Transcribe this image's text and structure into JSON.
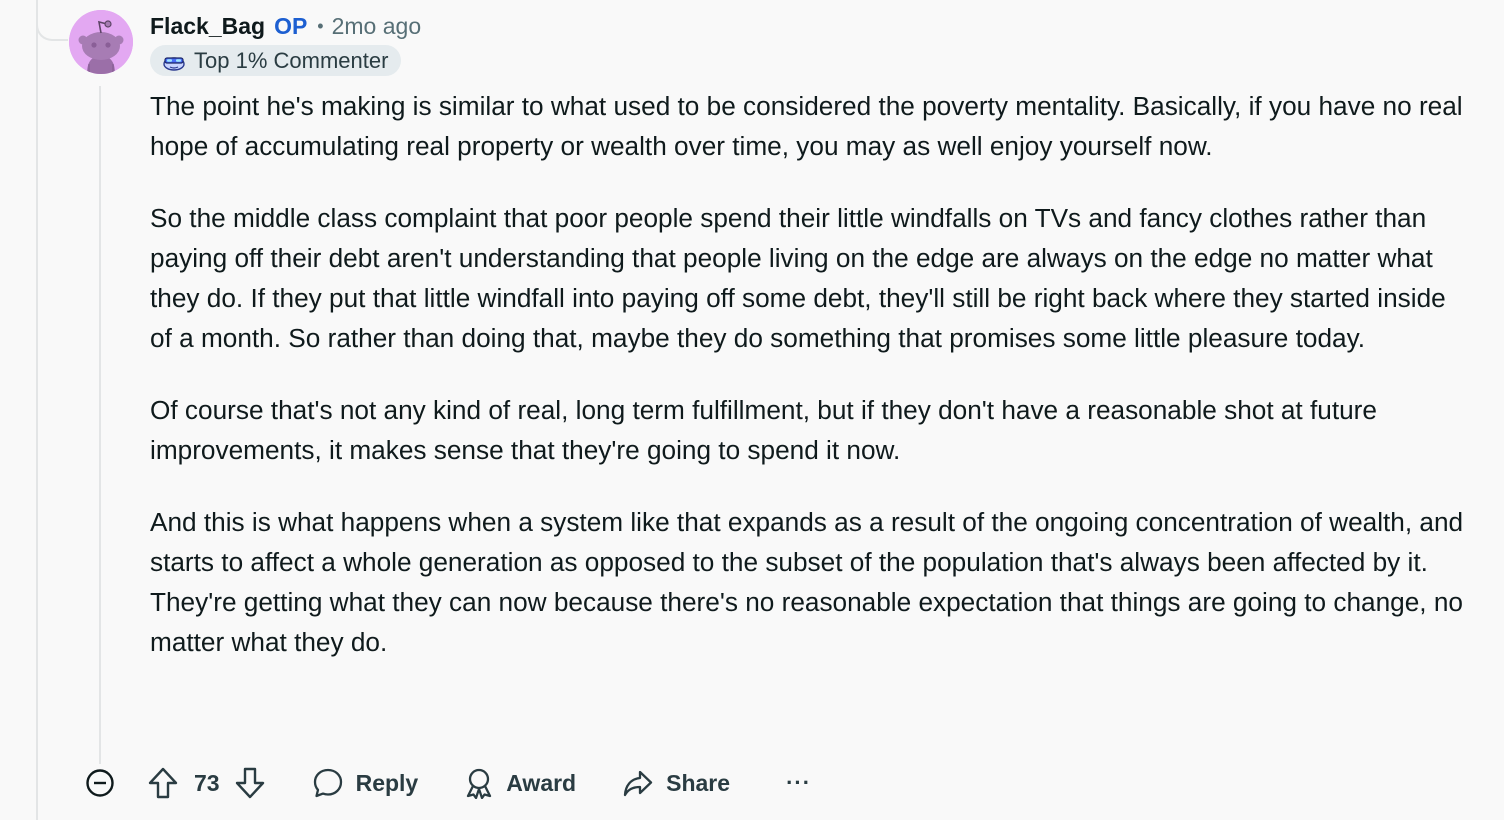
{
  "comment": {
    "username": "Flack_Bag",
    "op_tag": "OP",
    "separator": "•",
    "timestamp": "2mo ago",
    "flair": {
      "label": "Top 1% Commenter",
      "icon": "top-commenter-badge-icon"
    },
    "avatar": {
      "icon": "snoo-avatar-icon",
      "background": "#e3a8f2"
    },
    "paragraphs": [
      "The point he's making is similar to what used to be considered the poverty mentality. Basically, if you have no real hope of accumulating real property or wealth over time, you may as well enjoy yourself now.",
      "So the middle class complaint that poor people spend their little windfalls on TVs and fancy clothes rather than paying off their debt aren't understanding that people living on the edge are always on the edge no matter what they do. If they put that little windfall into paying off some debt, they'll still be right back where they started inside of a month. So rather than doing that, maybe they do something that promises some little pleasure today.",
      "Of course that's not any kind of real, long term fulfillment, but if they don't have a reasonable shot at future improvements, it makes sense that they're going to spend it now.",
      "And this is what happens when a system like that expands as a result of the ongoing concentration of wealth, and starts to affect a whole generation as opposed to the subset of the population that's always been affected by it. They're getting what they can now because there's no reasonable expectation that things are going to change, no matter what they do."
    ],
    "actions": {
      "collapse_icon": "collapse-minus-icon",
      "score": "73",
      "reply_label": "Reply",
      "award_label": "Award",
      "share_label": "Share",
      "more_label": "···"
    }
  },
  "colors": {
    "background": "#f9f9f9",
    "op_blue": "#1d5fd1",
    "meta_gray": "#576f76",
    "flair_bg": "#e5ebee",
    "thread_line": "#e3e5e6"
  }
}
